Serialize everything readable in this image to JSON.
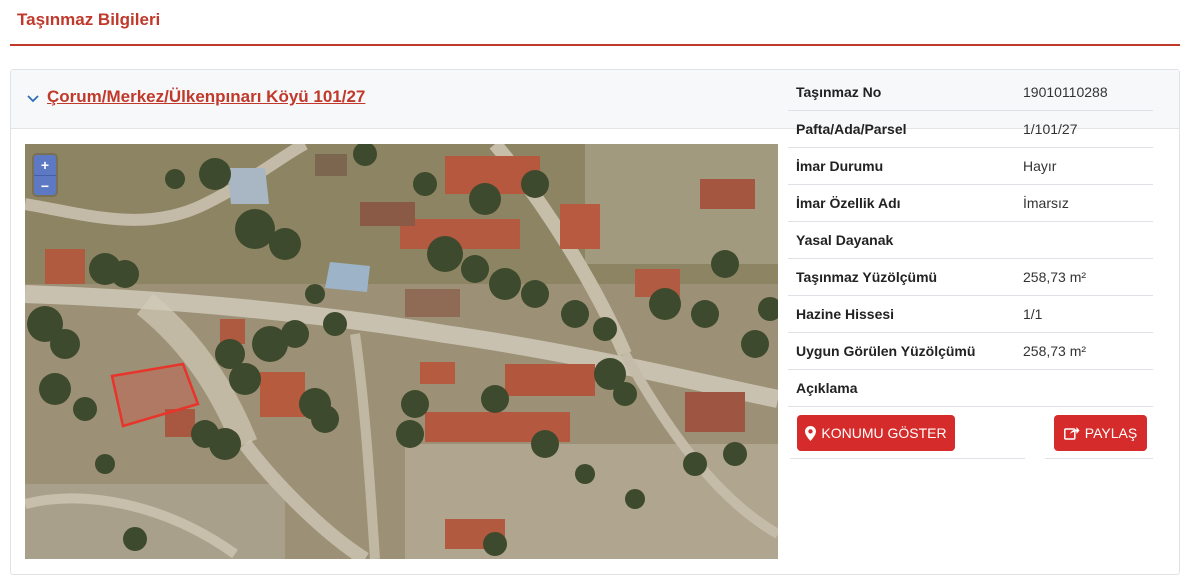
{
  "page": {
    "title": "Taşınmaz Bilgileri"
  },
  "card": {
    "title": "Çorum/Merkez/Ülkenpınarı Köyü 101/27"
  },
  "map": {
    "zoom_in": "+",
    "zoom_out": "−",
    "parcel_color": "#e8342a"
  },
  "details": {
    "rows": [
      {
        "label": "Taşınmaz No",
        "value": "19010110288"
      },
      {
        "label": "Pafta/Ada/Parsel",
        "value": "1/101/27"
      },
      {
        "label": "İmar Durumu",
        "value": "Hayır"
      },
      {
        "label": "İmar Özellik Adı",
        "value": "İmarsız"
      },
      {
        "label": "Yasal Dayanak",
        "value": ""
      },
      {
        "label": "Taşınmaz Yüzölçümü",
        "value": "258,73 m²"
      },
      {
        "label": "Hazine Hissesi",
        "value": "1/1"
      },
      {
        "label": "Uygun Görülen Yüzölçümü",
        "value": "258,73 m²"
      },
      {
        "label": "Açıklama",
        "value": ""
      }
    ]
  },
  "actions": {
    "locate_label": "KONUMU GÖSTER",
    "share_label": "PAYLAŞ"
  },
  "colors": {
    "accent": "#c0392b",
    "button": "#d52b2b",
    "zoom": "#5d79c4"
  },
  "icons": {
    "expand": "chevron-down-icon",
    "locate": "map-marker-icon",
    "share": "share-icon"
  }
}
